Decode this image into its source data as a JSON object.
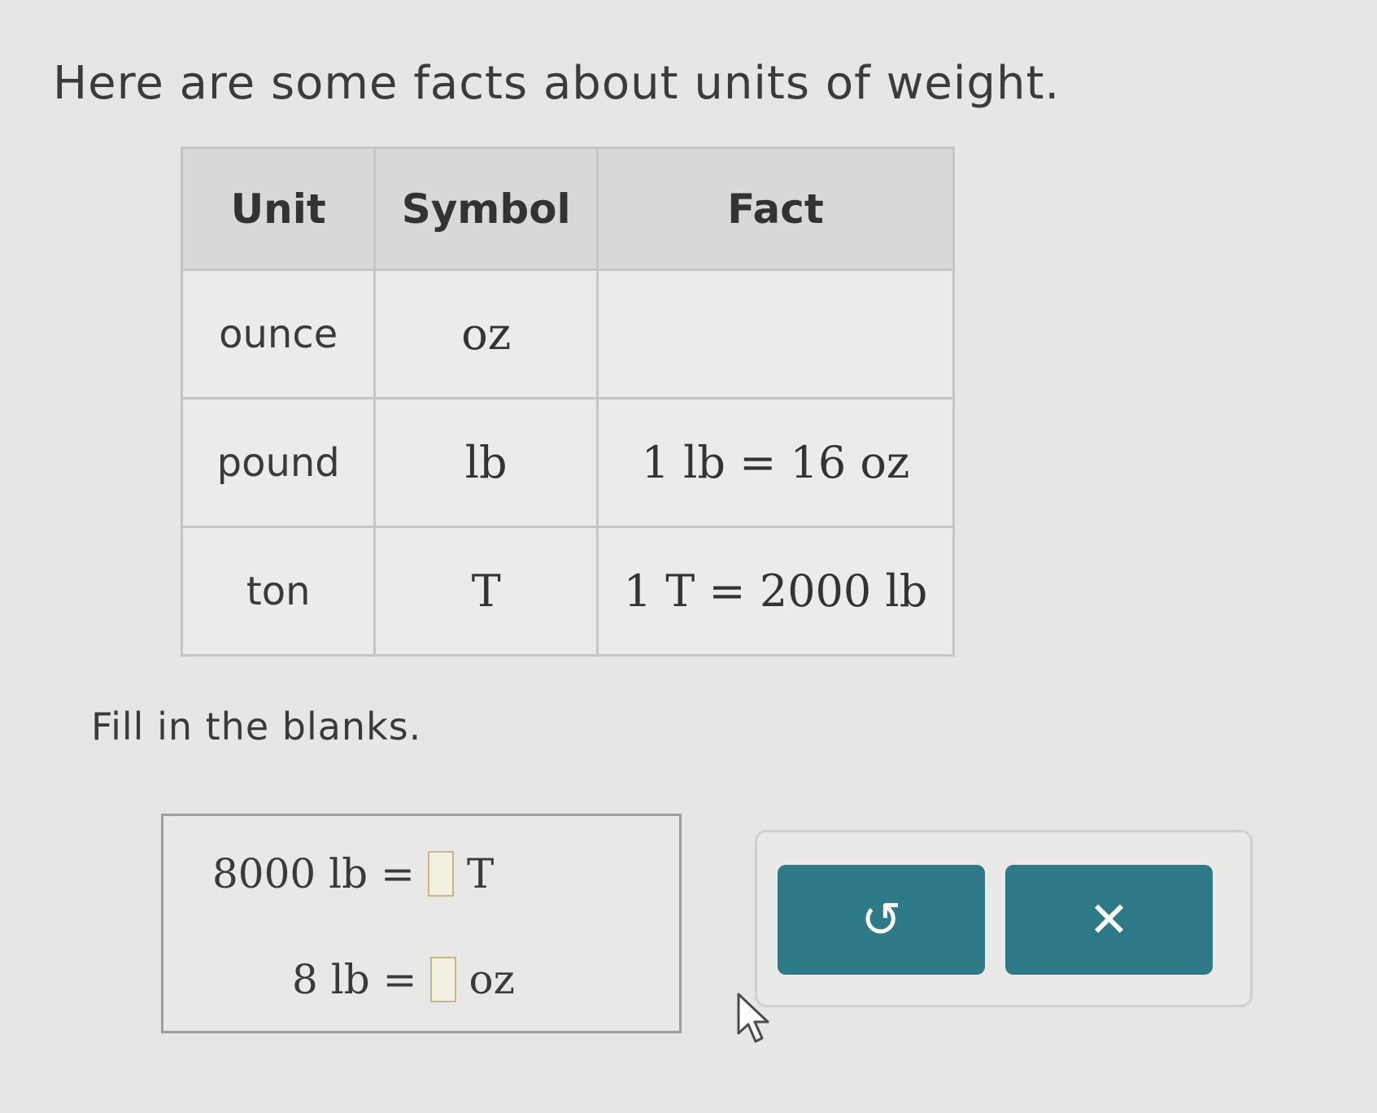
{
  "intro_text": "Here are some facts about units of weight.",
  "table": {
    "headers": [
      "Unit",
      "Symbol",
      "Fact"
    ],
    "rows": [
      {
        "unit": "ounce",
        "symbol": "oz",
        "fact": ""
      },
      {
        "unit": "pound",
        "symbol": "lb",
        "fact": "1 lb = 16 oz"
      },
      {
        "unit": "ton",
        "symbol": "T",
        "fact": "1 T = 2000 lb"
      }
    ]
  },
  "instruction": "Fill in the blanks.",
  "equations": [
    {
      "left": "8000 lb =",
      "right_unit": "T",
      "answer": ""
    },
    {
      "left": "8 lb =",
      "right_unit": "oz",
      "answer": ""
    }
  ],
  "buttons": {
    "undo_icon": "undo-icon",
    "clear_icon": "close-icon",
    "undo_glyph": "↺",
    "clear_glyph": "✕"
  },
  "colors": {
    "button_bg": "#2f7a88",
    "blank_border": "#c7b888"
  }
}
